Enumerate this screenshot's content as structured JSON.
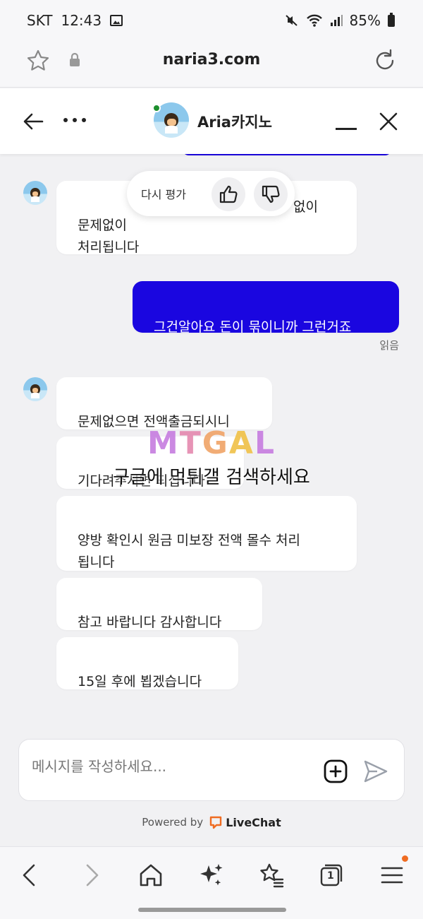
{
  "status_bar": {
    "carrier": "SKT",
    "time": "12:43",
    "battery": "85%"
  },
  "browser": {
    "url": "naria3.com"
  },
  "chat_header": {
    "agent_name": "Aria카지노"
  },
  "rating_popup": {
    "label": "다시 평가"
  },
  "messages": [
    {
      "direction": "in",
      "text": "문제없이\n처리됩니다",
      "hidden_tail": "없이"
    },
    {
      "direction": "out",
      "text": "그건알아요 돈이 묶이니까 그런거죠",
      "status": "읽음"
    },
    {
      "direction": "in",
      "text": "문제없으면 전액출금되시니"
    },
    {
      "direction": "in",
      "text": "기다려주시면 되십니다"
    },
    {
      "direction": "in",
      "text": "양방 확인시 원금 미보장 전액 몰수 처리\n됩니다"
    },
    {
      "direction": "in",
      "text": "참고 바랍니다 감사합니다"
    },
    {
      "direction": "in",
      "text": "15일 후에 뵙겠습니다"
    }
  ],
  "watermark": {
    "logo": "MTGAL",
    "caption": "구글에 먹튀갤 검색하세요"
  },
  "composer": {
    "placeholder": "메시지를 작성하세요..."
  },
  "footer": {
    "powered_by": "Powered by",
    "brand": "LiveChat"
  },
  "icons": {
    "status": [
      "gallery-icon",
      "mute-icon",
      "wifi-icon",
      "signal-icon",
      "battery-icon"
    ],
    "browser": [
      "bookmark-star-icon",
      "lock-icon",
      "reload-icon"
    ],
    "nav": [
      "back-icon",
      "forward-icon",
      "home-icon",
      "sparkle-icon",
      "bookmarks-icon",
      "tabs-icon",
      "menu-icon"
    ]
  },
  "nav": {
    "tab_count": "1"
  },
  "colors": {
    "accent": "#1a06e0",
    "livechat": "#ef6c22",
    "online": "#1d8f2e"
  }
}
